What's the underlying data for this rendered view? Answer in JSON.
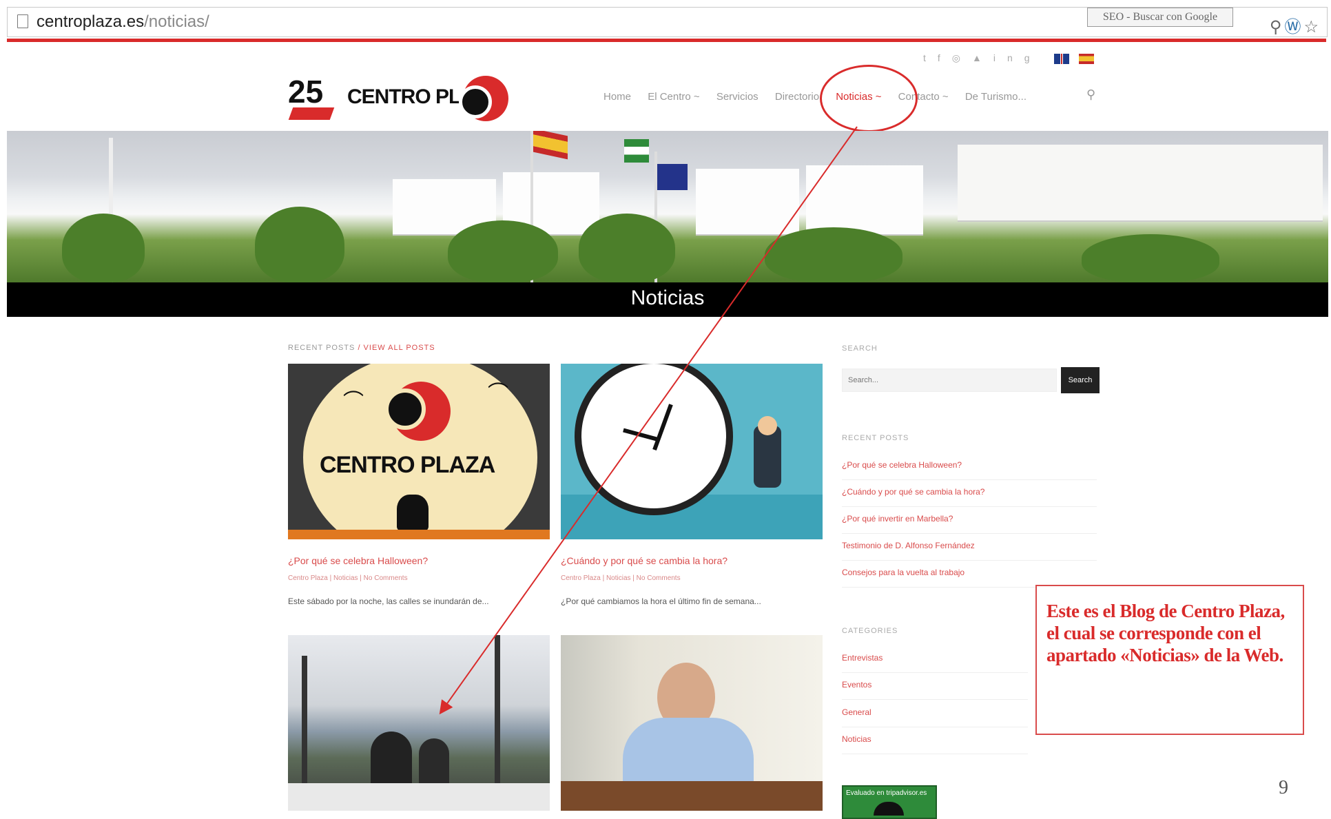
{
  "browser": {
    "url_host": "centroplaza.es",
    "url_path": "/noticias/",
    "search_tab": "SEO - Buscar con Google"
  },
  "header": {
    "logo_number": "25",
    "logo_brand": "CENTRO PLAZA",
    "nav": [
      "Home",
      "El Centro ~",
      "Servicios",
      "Directorio",
      "Noticias ~",
      "Contacto ~",
      "De Turismo..."
    ],
    "active_nav_index": 4
  },
  "page_title": "Noticias",
  "recent_posts": {
    "label": "RECENT POSTS",
    "view_all": "/ VIEW ALL POSTS"
  },
  "posts": [
    {
      "title": "¿Por qué se celebra Halloween?",
      "meta": "Centro Plaza | Noticias | No Comments",
      "excerpt": "Este sábado por la noche, las calles se inundarán de..."
    },
    {
      "title": "¿Cuándo y por qué se cambia la hora?",
      "meta": "Centro Plaza | Noticias | No Comments",
      "excerpt": "¿Por qué cambiamos la hora el último fin de semana..."
    }
  ],
  "thumb_logo_text": "CENTRO PLAZA",
  "sidebar": {
    "search_heading": "SEARCH",
    "search_placeholder": "Search...",
    "search_button": "Search",
    "recent_heading": "RECENT POSTS",
    "recent_links": [
      "¿Por qué se celebra Halloween?",
      "¿Cuándo y por qué se cambia la hora?",
      "¿Por qué invertir en Marbella?",
      "Testimonio de D. Alfonso Fernández",
      "Consejos para la vuelta al trabajo"
    ],
    "categories_heading": "CATEGORIES",
    "categories": [
      "Entrevistas",
      "Eventos",
      "General",
      "Noticias"
    ],
    "tripadvisor": "Evaluado en tripadvisor.es"
  },
  "annotation": {
    "text": "Este es el Blog de Centro Plaza, el cual se corresponde con el apartado «Noticias» de la Web."
  },
  "page_number": "9",
  "colors": {
    "accent": "#d92b2b",
    "link": "#d94b4b",
    "titlebar": "#000000"
  }
}
